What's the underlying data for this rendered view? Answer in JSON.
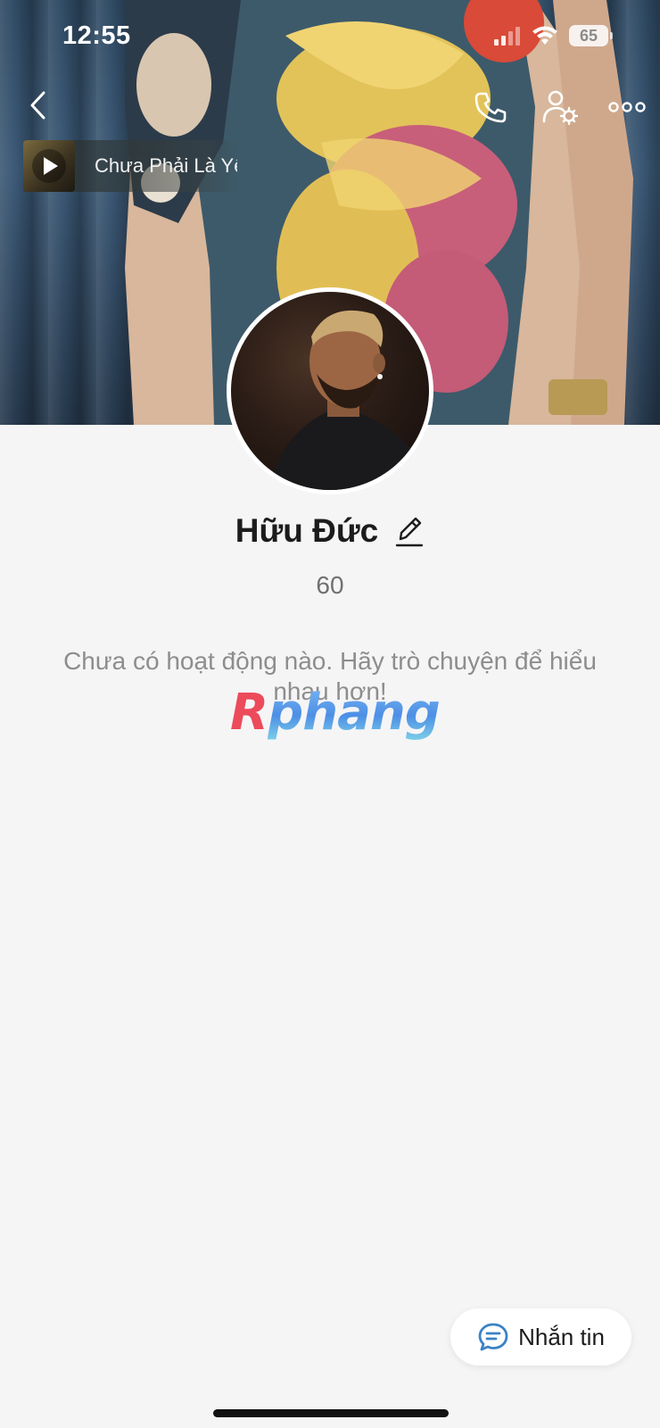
{
  "status_bar": {
    "time": "12:55",
    "battery_level": "65",
    "signal_icon": "cellular-signal-icon",
    "wifi_icon": "wifi-icon"
  },
  "nav": {
    "back_icon": "chevron-left-icon",
    "call_icon": "phone-icon",
    "settings_icon": "user-settings-icon",
    "more_icon": "more-dots-icon"
  },
  "music": {
    "title": "Chưa Phải Là Yêu",
    "play_icon": "play-icon"
  },
  "profile": {
    "name": "Hữu Đức",
    "edit_icon": "pencil-icon",
    "sub_text": "60",
    "empty_message": "Chưa có hoạt động nào. Hãy trò chuyện để hiểu nhau hơn!"
  },
  "watermark": {
    "first": "R",
    "rest": "phang"
  },
  "message_button": {
    "label": "Nhắn tin",
    "icon": "chat-bubble-icon"
  },
  "colors": {
    "background": "#f5f5f6",
    "accent": "#3b82c4",
    "text": "#1c1c1c",
    "muted": "#8d8d8d"
  }
}
